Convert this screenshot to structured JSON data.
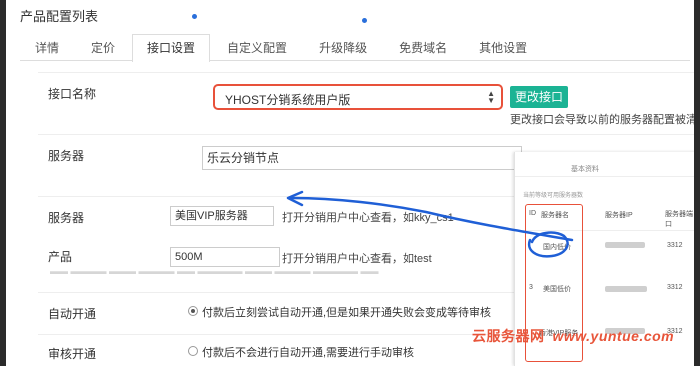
{
  "page": {
    "title": "产品配置列表"
  },
  "tabs": [
    {
      "label": "详情"
    },
    {
      "label": "定价"
    },
    {
      "label": "接口设置"
    },
    {
      "label": "自定义配置"
    },
    {
      "label": "升级降级"
    },
    {
      "label": "免费域名"
    },
    {
      "label": "其他设置"
    }
  ],
  "active_tab": "接口设置",
  "interface": {
    "label": "接口名称",
    "selected": "YHOST分销系统用户版",
    "button": "更改接口",
    "warning": "更改接口会导致以前的服务器配置被清除,请谨"
  },
  "server_group": {
    "label": "服务器",
    "value": "乐云分销节点"
  },
  "server": {
    "label": "服务器",
    "value": "美国VIP服务器",
    "hint": "打开分销用户中心查看，如kky_cs1"
  },
  "product": {
    "label": "产品",
    "value": "500M",
    "hint": "打开分销用户中心查看，如test"
  },
  "auto_open": {
    "label": "自动开通",
    "option": "付款后立刻尝试自动开通,但是如果开通失败会变成等待审核"
  },
  "review_open": {
    "label": "审核开通",
    "option": "付款后不会进行自动开通,需要进行手动审核"
  },
  "inset": {
    "tab": "基本资料",
    "table_title": "当前等级可用服务器数",
    "headers": [
      "ID",
      "服务器名",
      "服务器IP",
      "服务器端口"
    ],
    "rows": [
      {
        "id": "",
        "name": "国内低价",
        "port": "3312"
      },
      {
        "id": "3",
        "name": "美国低价",
        "port": "3312"
      },
      {
        "id": "",
        "name": "香港VIP服务",
        "port": "3312"
      }
    ]
  },
  "watermark": {
    "cn": "云服务器网",
    "url": "www.yuntue.com"
  },
  "colors": {
    "accent_red": "#e8513a",
    "green_button": "#1bb394",
    "arrow_blue": "#1f5fd6"
  }
}
